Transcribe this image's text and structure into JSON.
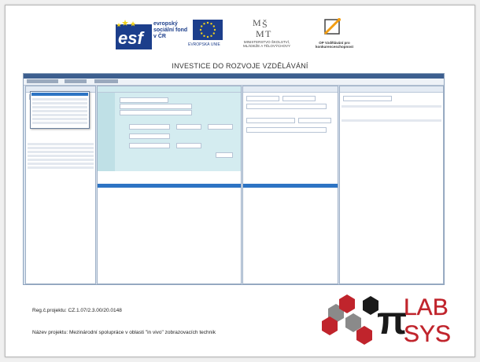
{
  "logos": {
    "esf_text": "evropský sociální fond v ČR",
    "eu_caption": "EVROPSKÁ UNIE",
    "msmt_caption": "MINISTERSTVO ŠKOLSTVÍ, MLÁDEŽE A TĚLOVÝCHOVY",
    "op_caption": "OP Vzdělávání pro konkurenceschopnost"
  },
  "banner": "INVESTICE DO ROZVOJE VZDĚLÁVÁNÍ",
  "lab_logo": "LAB SYS",
  "footer": {
    "reg": "Reg.č.projektu: CZ.1.07/2.3.00/20.0148",
    "name": "Název projektu: Mezinárodní spolupráce v oblasti \"in vivo\" zobrazovacích technik"
  },
  "colors": {
    "esf_blue": "#1c3e8b",
    "eu_gold": "#f2d21b",
    "lab_red": "#c0242c",
    "app_blue": "#3d5f8f",
    "selection": "#2d74c4",
    "teal_panel": "#d4ecf0"
  }
}
